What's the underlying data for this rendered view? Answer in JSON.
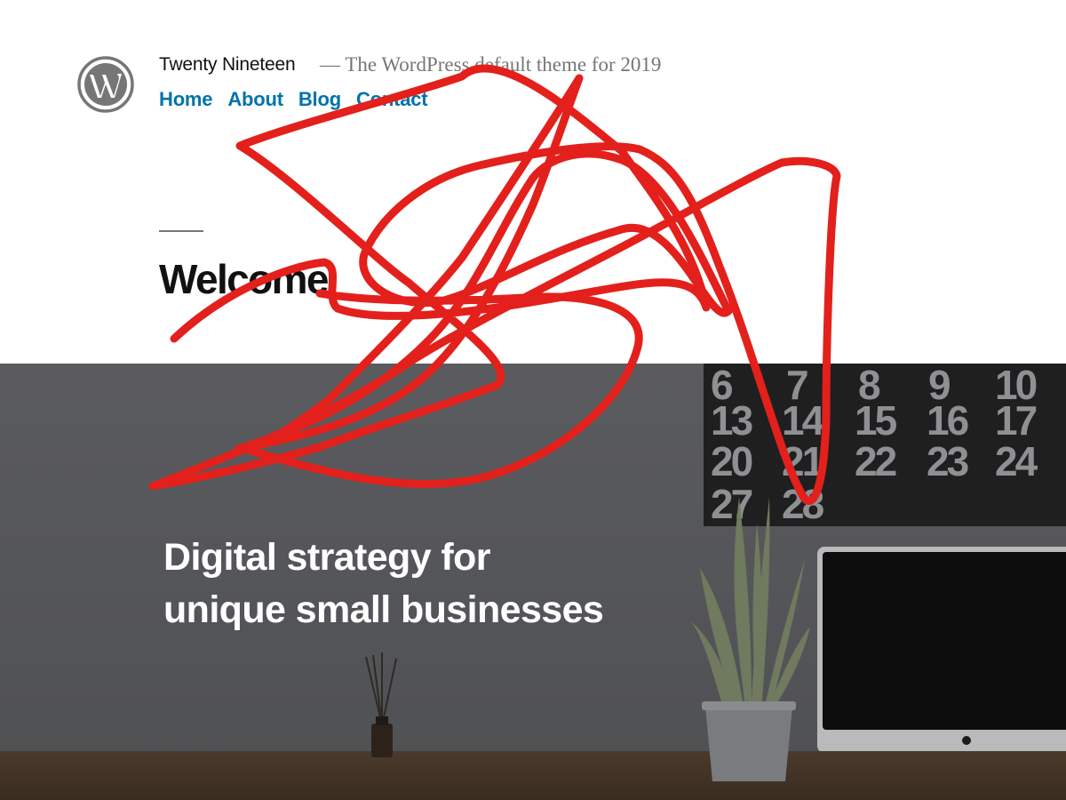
{
  "site": {
    "title": "Twenty Nineteen",
    "tagline": "— The WordPress default theme for 2019",
    "logo_icon": "wordpress-logo-icon"
  },
  "nav": {
    "items": [
      {
        "label": "Home"
      },
      {
        "label": "About"
      },
      {
        "label": "Blog"
      },
      {
        "label": "Contact"
      }
    ]
  },
  "main": {
    "page_title": "Welcome"
  },
  "hero": {
    "heading_line1": "Digital strategy for",
    "heading_line2": "unique small businesses",
    "calendar_numbers": [
      [
        "6",
        "7",
        "8",
        "9",
        "10"
      ],
      [
        "13",
        "14",
        "15",
        "16",
        "17"
      ],
      [
        "20",
        "21",
        "22",
        "23",
        "24"
      ],
      [
        "27",
        "28"
      ]
    ]
  },
  "colors": {
    "link": "#0073aa",
    "text": "#111111",
    "muted": "#767676",
    "hero_overlay": "#56575a",
    "scribble": "#e3201b"
  }
}
